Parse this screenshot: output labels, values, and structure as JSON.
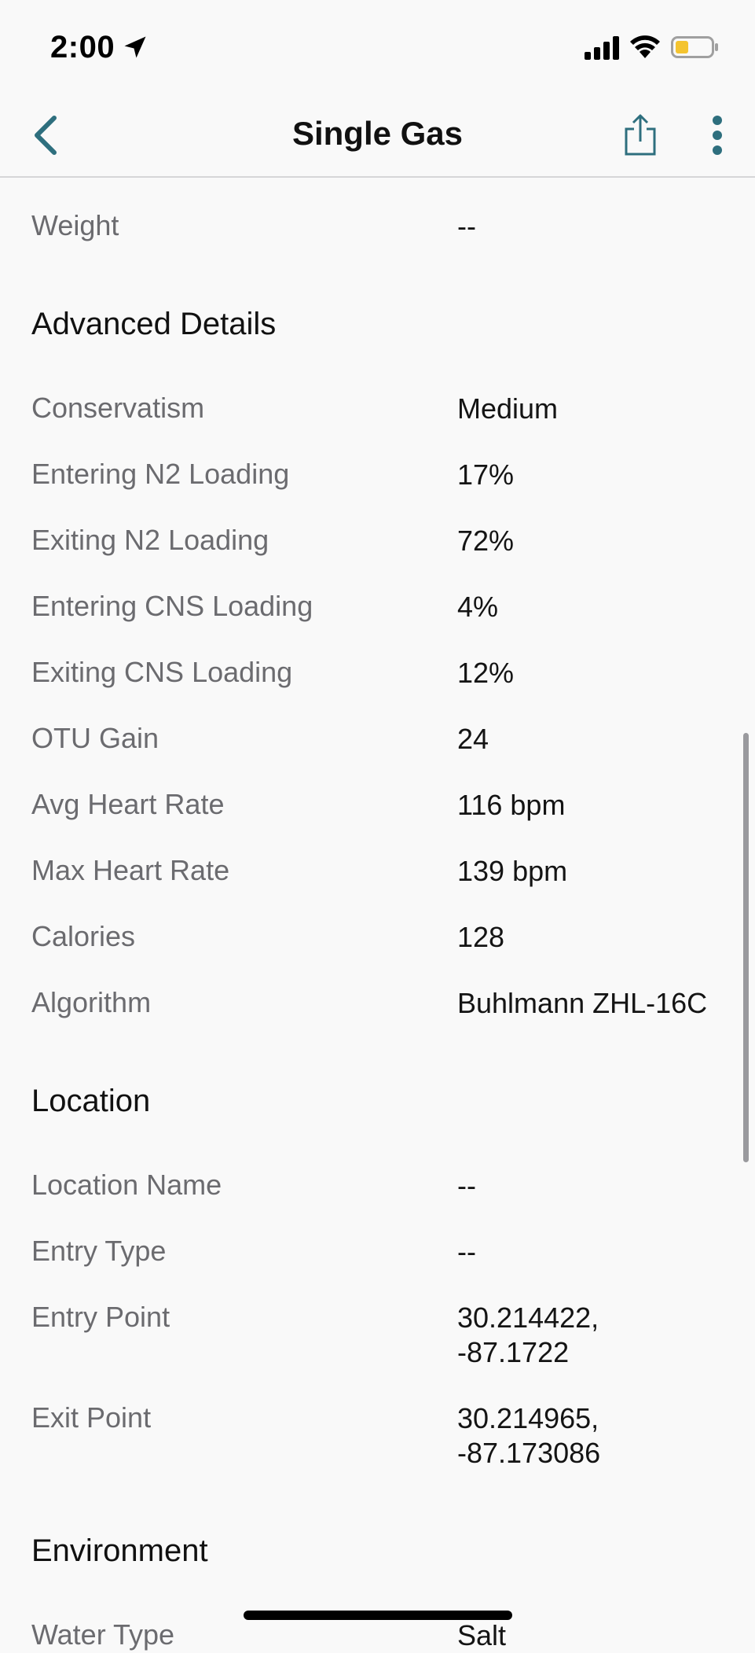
{
  "status_bar": {
    "time": "2:00"
  },
  "nav": {
    "title": "Single Gas"
  },
  "rows_top": [
    {
      "label": "Weight",
      "value": "--"
    }
  ],
  "sections": [
    {
      "heading": "Advanced Details",
      "rows": [
        {
          "label": "Conservatism",
          "value": "Medium"
        },
        {
          "label": "Entering N2 Loading",
          "value": "17%"
        },
        {
          "label": "Exiting N2 Loading",
          "value": "72%"
        },
        {
          "label": "Entering CNS Loading",
          "value": "4%"
        },
        {
          "label": "Exiting CNS Loading",
          "value": "12%"
        },
        {
          "label": "OTU Gain",
          "value": "24"
        },
        {
          "label": "Avg Heart Rate",
          "value": "116 bpm"
        },
        {
          "label": "Max Heart Rate",
          "value": "139 bpm"
        },
        {
          "label": "Calories",
          "value": "128"
        },
        {
          "label": "Algorithm",
          "value": "Buhlmann ZHL-16C"
        }
      ]
    },
    {
      "heading": "Location",
      "rows": [
        {
          "label": "Location Name",
          "value": "--"
        },
        {
          "label": "Entry Type",
          "value": "--"
        },
        {
          "label": "Entry Point",
          "value": "30.214422,\n-87.1722"
        },
        {
          "label": "Exit Point",
          "value": "30.214965,\n-87.173086"
        }
      ]
    },
    {
      "heading": "Environment",
      "rows": [
        {
          "label": "Water Type",
          "value": "Salt"
        }
      ]
    }
  ],
  "icons": {
    "back": "chevron-left-icon",
    "share": "share-icon",
    "more": "more-vertical-icon"
  },
  "colors": {
    "accent": "#2e6f7e",
    "battery_fill": "#f4c430"
  }
}
